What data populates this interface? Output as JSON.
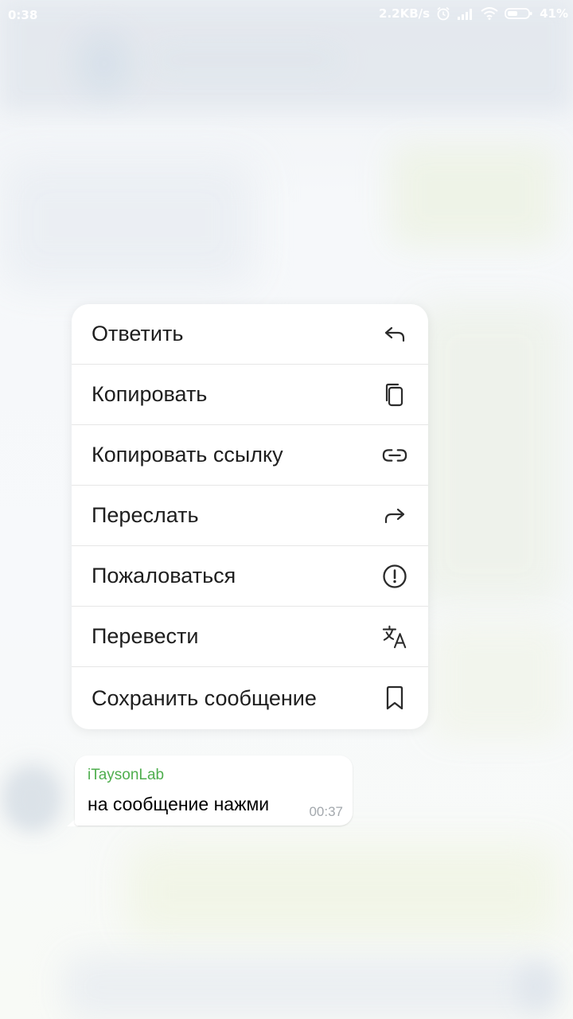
{
  "status_bar": {
    "time": "0:38",
    "network_speed": "2.2KB/s",
    "battery": "41%",
    "icons": [
      "alarm-icon",
      "signal-icon",
      "wifi-icon",
      "battery-icon"
    ]
  },
  "context_menu": {
    "items": [
      {
        "label": "Ответить",
        "icon": "reply-icon"
      },
      {
        "label": "Копировать",
        "icon": "copy-icon"
      },
      {
        "label": "Копировать ссылку",
        "icon": "link-icon"
      },
      {
        "label": "Переслать",
        "icon": "forward-icon"
      },
      {
        "label": "Пожаловаться",
        "icon": "report-icon"
      },
      {
        "label": "Перевести",
        "icon": "translate-icon"
      },
      {
        "label": "Сохранить сообщение",
        "icon": "bookmark-icon"
      }
    ]
  },
  "message": {
    "sender": "iTaysonLab",
    "text": "на сообщение нажми",
    "time": "00:37"
  },
  "colors": {
    "sender_name": "#4fae4e",
    "menu_background": "#ffffff",
    "menu_text": "#1e1e1e",
    "time_text": "#a3a8ad"
  }
}
